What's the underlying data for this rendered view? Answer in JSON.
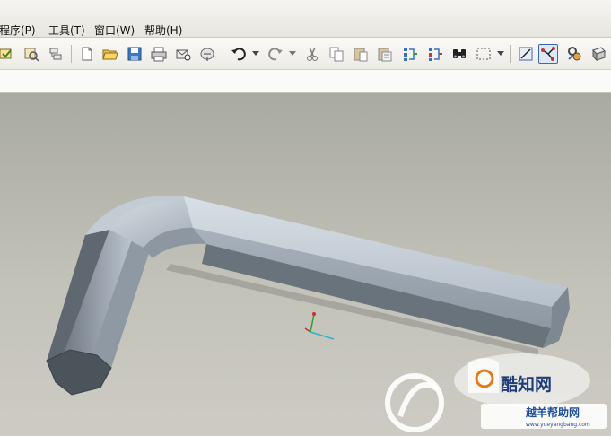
{
  "menubar": {
    "items": [
      {
        "label": "程序(P)"
      },
      {
        "label": "工具(T)"
      },
      {
        "label": "窗口(W)"
      },
      {
        "label": "帮助(H)"
      }
    ]
  },
  "toolbar": {
    "buttons": [
      {
        "icon": "select-toggle-icon"
      },
      {
        "icon": "select-filter-icon"
      },
      {
        "icon": "select-pick-icon"
      },
      {
        "icon": "new-file-icon"
      },
      {
        "icon": "open-folder-icon"
      },
      {
        "icon": "save-icon"
      },
      {
        "icon": "print-icon"
      },
      {
        "icon": "send-mail-icon"
      },
      {
        "icon": "redo-model-icon"
      },
      {
        "icon": "undo-icon"
      },
      {
        "icon": "redo-icon"
      },
      {
        "icon": "cut-icon"
      },
      {
        "icon": "copy-icon"
      },
      {
        "icon": "paste-icon"
      },
      {
        "icon": "paste-special-icon"
      },
      {
        "icon": "regenerate-icon"
      },
      {
        "icon": "regenerate-manager-icon"
      },
      {
        "icon": "find-icon"
      },
      {
        "icon": "select-box-icon"
      },
      {
        "icon": "sketch-edit-icon"
      },
      {
        "icon": "datum-display-icon"
      },
      {
        "icon": "settings-icon"
      },
      {
        "icon": "shading-icon"
      }
    ],
    "active_icon": "datum-display-icon"
  },
  "watermark": {
    "site_name": "酷知网",
    "brand": "越羊帮助网",
    "url": "www.yueyangbang.com"
  },
  "colors": {
    "viewport_top": "#a9aaa1",
    "viewport_bottom": "#cdcbc3",
    "model_light": "#c8d0d9",
    "model_dark": "#5f6870",
    "active_border": "#3a68b6"
  }
}
